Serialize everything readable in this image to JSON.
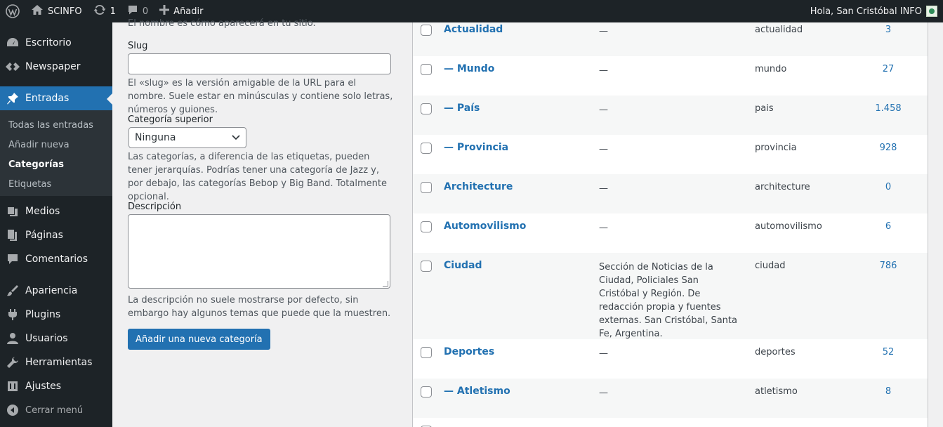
{
  "adminbar": {
    "site_name": "SCINFO",
    "updates_count": "1",
    "comments_count": "0",
    "add_new_label": "Añadir",
    "greeting": "Hola, San Cristóbal INFO"
  },
  "sidebar": {
    "items": [
      {
        "label": "Escritorio",
        "icon": "dashboard-icon"
      },
      {
        "label": "Newspaper",
        "icon": "newspaper-icon"
      },
      {
        "label": "Entradas",
        "icon": "pin-icon"
      },
      {
        "label": "Medios",
        "icon": "media-icon"
      },
      {
        "label": "Páginas",
        "icon": "pages-icon"
      },
      {
        "label": "Comentarios",
        "icon": "comments-icon"
      },
      {
        "label": "Apariencia",
        "icon": "appearance-icon"
      },
      {
        "label": "Plugins",
        "icon": "plugins-icon"
      },
      {
        "label": "Usuarios",
        "icon": "users-icon"
      },
      {
        "label": "Herramientas",
        "icon": "tools-icon"
      },
      {
        "label": "Ajustes",
        "icon": "settings-icon"
      }
    ],
    "submenu": [
      "Todas las entradas",
      "Añadir nueva",
      "Categorías",
      "Etiquetas"
    ],
    "collapse_label": "Cerrar menú"
  },
  "form": {
    "name_help": "El nombre es cómo aparecerá en tu sitio.",
    "slug_label": "Slug",
    "slug_value": "",
    "slug_help": "El «slug» es la versión amigable de la URL para el nombre. Suele estar en minúsculas y contiene solo letras, números y guiones.",
    "parent_label": "Categoría superior",
    "parent_value": "Ninguna",
    "parent_help": "Las categorías, a diferencia de las etiquetas, pueden tener jerarquías. Podrías tener una categoría de Jazz y, por debajo, las categorías Bebop y Big Band. Totalmente opcional.",
    "description_label": "Descripción",
    "description_value": "",
    "description_help": "La descripción no suele mostrarse por defecto, sin embargo hay algunos temas que puede que la muestren.",
    "submit_label": "Añadir una nueva categoría"
  },
  "categories": {
    "rows": [
      {
        "name": "Actualidad",
        "description": "—",
        "slug": "actualidad",
        "count": "3"
      },
      {
        "name": "— Mundo",
        "description": "—",
        "slug": "mundo",
        "count": "27"
      },
      {
        "name": "— País",
        "description": "—",
        "slug": "pais",
        "count": "1.458"
      },
      {
        "name": "— Provincia",
        "description": "—",
        "slug": "provincia",
        "count": "928"
      },
      {
        "name": "Architecture",
        "description": "—",
        "slug": "architecture",
        "count": "0"
      },
      {
        "name": "Automovilismo",
        "description": "—",
        "slug": "automovilismo",
        "count": "6"
      },
      {
        "name": "Ciudad",
        "description": "Sección de Noticias de la Ciudad, Policiales San Cristóbal y Región. De redacción propia y fuentes externas. San Cristóbal, Santa Fe, Argentina.",
        "slug": "ciudad",
        "count": "786"
      },
      {
        "name": "Deportes",
        "description": "—",
        "slug": "deportes",
        "count": "52"
      },
      {
        "name": "— Atletismo",
        "description": "—",
        "slug": "atletismo",
        "count": "8"
      }
    ]
  },
  "colors": {
    "adminbar_bg": "#1d2327",
    "accent": "#2271b1",
    "page_bg": "#f0f0f1"
  }
}
